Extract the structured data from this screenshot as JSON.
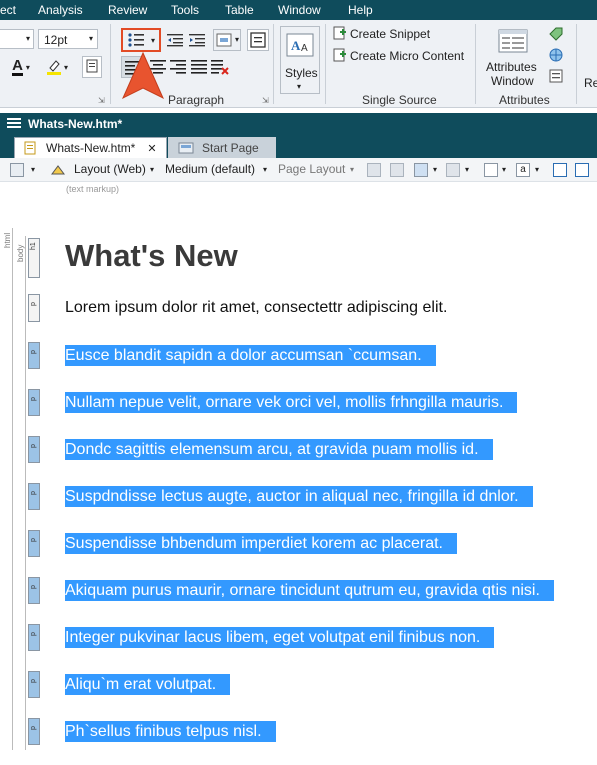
{
  "menubar": {
    "items": [
      "ect",
      "Analysis",
      "Review",
      "Tools",
      "Table",
      "Window",
      "Help"
    ]
  },
  "ribbon": {
    "font_size": "12pt",
    "styles_label": "Styles",
    "paragraph_group_label": "Paragraph",
    "create_snippet": "Create Snippet",
    "create_micro_content": "Create Micro Content",
    "single_source_label": "Single Source",
    "attributes_window_line1": "Attributes",
    "attributes_window_line2": "Window",
    "attributes_group_label": "Attributes",
    "cut_off_label": "Re"
  },
  "document": {
    "window_title": "Whats-New.htm*",
    "tabs": [
      {
        "label": "Whats-New.htm*",
        "active": true
      },
      {
        "label": "Start Page",
        "active": false
      }
    ],
    "toolbar": {
      "layout": "Layout (Web)",
      "medium": "Medium (default)",
      "page_layout": "Page Layout",
      "text_markup": "(text markup)"
    },
    "gutter": {
      "html": "html",
      "body": "body",
      "h1": "h1",
      "p": "p"
    }
  },
  "content": {
    "heading": "What's New",
    "paragraphs": [
      {
        "text": "Lorem ipsum dolor rit amet, consectettr adipiscing elit.",
        "selected": false
      },
      {
        "text": "Eusce blandit sapidn a dolor accumsan `ccumsan.",
        "selected": true
      },
      {
        "text": "Nullam nepue velit, ornare vek orci vel, mollis frhngilla mauris.",
        "selected": true
      },
      {
        "text": "Dondc sagittis elemensum arcu, at gravida puam mollis id.",
        "selected": true
      },
      {
        "text": "Suspdndisse lectus augte, auctor in aliqual nec, fringilla id dnlor.",
        "selected": true
      },
      {
        "text": "Suspendisse bhbendum imperdiet korem ac placerat.",
        "selected": true
      },
      {
        "text": "Akiquam purus maurir, ornare tincidunt qutrum eu, gravida qtis nisi.",
        "selected": true
      },
      {
        "text": "Integer pukvinar lacus libem, eget volutpat enil finibus non.",
        "selected": true
      },
      {
        "text": "Aliqu`m erat volutpat.",
        "selected": true
      },
      {
        "text": "Ph`sellus finibus telpus nisl.",
        "selected": true
      }
    ]
  },
  "colors": {
    "titlebar": "#0f4c5c",
    "selection": "#3399ff",
    "highlight_box": "#e24b26",
    "arrow": "#e8542f"
  }
}
